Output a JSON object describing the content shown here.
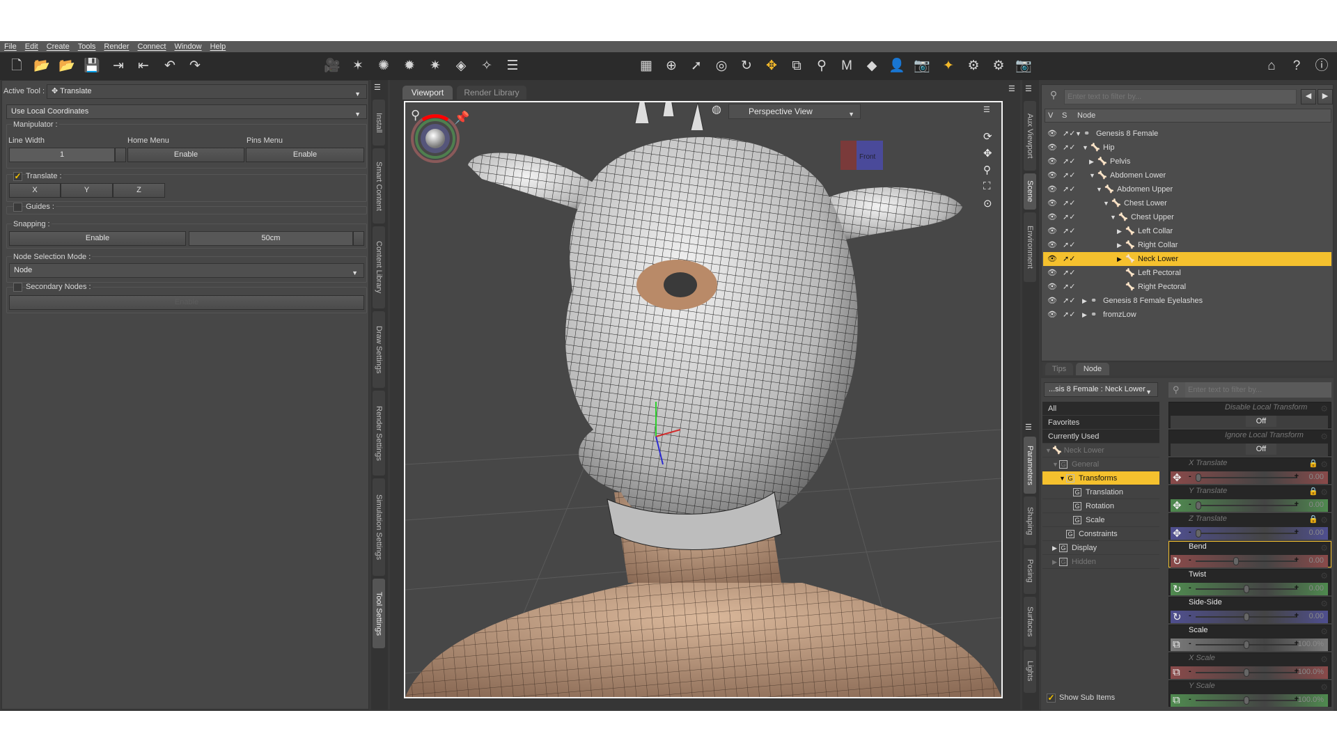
{
  "menu": [
    "File",
    "Edit",
    "Create",
    "Tools",
    "Render",
    "Connect",
    "Window",
    "Help"
  ],
  "tool_settings": {
    "active_tool_label": "Active Tool :",
    "active_tool": "Translate",
    "coordinates": "Use Local Coordinates",
    "manipulator_label": "Manipulator :",
    "line_width_label": "Line Width",
    "line_width_value": "1",
    "home_menu_label": "Home Menu",
    "home_menu_button": "Enable",
    "pins_menu_label": "Pins Menu",
    "pins_menu_button": "Enable",
    "translate_label": "Translate :",
    "translate_checked": true,
    "axes": [
      "X",
      "Y",
      "Z"
    ],
    "guides_label": "Guides :",
    "snapping_label": "Snapping :",
    "snapping_button": "Enable",
    "snapping_value": "50cm",
    "node_selection_label": "Node Selection Mode :",
    "node_selection_value": "Node",
    "secondary_nodes_label": "Secondary Nodes :",
    "secondary_button": "Enable"
  },
  "left_vtabs": [
    "Install",
    "Smart Content",
    "Content Library",
    "Draw Settings",
    "Render Settings",
    "Simulation Settings",
    "Tool Settings"
  ],
  "viewport": {
    "tabs": [
      "Viewport",
      "Render Library"
    ],
    "view_mode": "Perspective View",
    "cube_face": "Front"
  },
  "right_vtabs_top": [
    "Aux Viewport",
    "Scene",
    "Environment"
  ],
  "right_vtabs_bottom": [
    "Parameters",
    "Shaping",
    "Posing",
    "Surfaces",
    "Lights"
  ],
  "scene": {
    "filter_placeholder": "Enter text to filter by...",
    "columns": [
      "V",
      "S",
      "Node"
    ],
    "nodes": [
      {
        "label": "Genesis 8 Female",
        "depth": 0,
        "expander": "▼",
        "icon": "figure"
      },
      {
        "label": "Hip",
        "depth": 1,
        "expander": "▼",
        "icon": "bone"
      },
      {
        "label": "Pelvis",
        "depth": 2,
        "expander": "▶",
        "icon": "bone"
      },
      {
        "label": "Abdomen Lower",
        "depth": 2,
        "expander": "▼",
        "icon": "bone"
      },
      {
        "label": "Abdomen Upper",
        "depth": 3,
        "expander": "▼",
        "icon": "bone"
      },
      {
        "label": "Chest Lower",
        "depth": 4,
        "expander": "▼",
        "icon": "bone"
      },
      {
        "label": "Chest Upper",
        "depth": 5,
        "expander": "▼",
        "icon": "bone"
      },
      {
        "label": "Left Collar",
        "depth": 6,
        "expander": "▶",
        "icon": "bone"
      },
      {
        "label": "Right Collar",
        "depth": 6,
        "expander": "▶",
        "icon": "bone"
      },
      {
        "label": "Neck Lower",
        "depth": 6,
        "expander": "▶",
        "icon": "bone",
        "selected": true
      },
      {
        "label": "Left Pectoral",
        "depth": 6,
        "expander": "",
        "icon": "bone"
      },
      {
        "label": "Right Pectoral",
        "depth": 6,
        "expander": "",
        "icon": "bone"
      },
      {
        "label": "Genesis 8 Female Eyelashes",
        "depth": 1,
        "expander": "▶",
        "icon": "figure"
      },
      {
        "label": "fromzLow",
        "depth": 1,
        "expander": "▶",
        "icon": "figure"
      }
    ],
    "bottom_tabs": [
      "Tips",
      "Node"
    ]
  },
  "parameters": {
    "node_select": "...sis 8 Female : Neck Lower",
    "filter_placeholder": "Enter text to filter by...",
    "categories": [
      "All",
      "Favorites",
      "Currently Used"
    ],
    "tree": [
      {
        "label": "Neck Lower",
        "depth": 0,
        "expander": "▼",
        "dim": true,
        "icon": "bone"
      },
      {
        "label": "General",
        "depth": 1,
        "expander": "▼",
        "dim": true
      },
      {
        "label": "Transforms",
        "depth": 2,
        "expander": "▼",
        "selected": true
      },
      {
        "label": "Translation",
        "depth": 3,
        "expander": ""
      },
      {
        "label": "Rotation",
        "depth": 3,
        "expander": ""
      },
      {
        "label": "Scale",
        "depth": 3,
        "expander": ""
      },
      {
        "label": "Constraints",
        "depth": 2,
        "expander": ""
      },
      {
        "label": "Display",
        "depth": 1,
        "expander": "▶"
      },
      {
        "label": "Hidden",
        "depth": 1,
        "expander": "▶",
        "dim": true
      }
    ],
    "show_sub_items": "Show Sub Items",
    "toggles": [
      {
        "name": "Disable Local Transform",
        "value": "Off"
      },
      {
        "name": "Ignore Local Transform",
        "value": "Off"
      }
    ],
    "sliders": [
      {
        "name": "X Translate",
        "value": "0.00",
        "fraction": 0.0,
        "color": "#8a4a4a",
        "dim": true,
        "lock": true,
        "icon": "✥"
      },
      {
        "name": "Y Translate",
        "value": "0.00",
        "fraction": 0.0,
        "color": "#4f8a4f",
        "dim": true,
        "lock": true,
        "icon": "✥"
      },
      {
        "name": "Z Translate",
        "value": "0.00",
        "fraction": 0.0,
        "color": "#4f4f8f",
        "dim": true,
        "lock": true,
        "icon": "✥"
      },
      {
        "name": "Bend",
        "value": "0.00",
        "fraction": 0.39,
        "color": "#8a4a4a",
        "highlight": true,
        "icon": "↻"
      },
      {
        "name": "Twist",
        "value": "0.00",
        "fraction": 0.5,
        "color": "#4f8a4f",
        "icon": "↻"
      },
      {
        "name": "Side-Side",
        "value": "0.00",
        "fraction": 0.5,
        "color": "#4f4f8f",
        "icon": "↻"
      },
      {
        "name": "Scale",
        "value": "100.0%",
        "fraction": 0.5,
        "color": "#7a7a7a",
        "icon": "⧉"
      },
      {
        "name": "X Scale",
        "value": "100.0%",
        "fraction": 0.5,
        "color": "#8a4a4a",
        "dim": true,
        "icon": "⧉"
      },
      {
        "name": "Y Scale",
        "value": "100.0%",
        "fraction": 0.5,
        "color": "#4f8a4f",
        "dim": true,
        "icon": "⧉"
      }
    ]
  },
  "colors": {
    "accent": "#f5c12e",
    "panel": "#474747",
    "toolbar": "#2b2b2b"
  }
}
